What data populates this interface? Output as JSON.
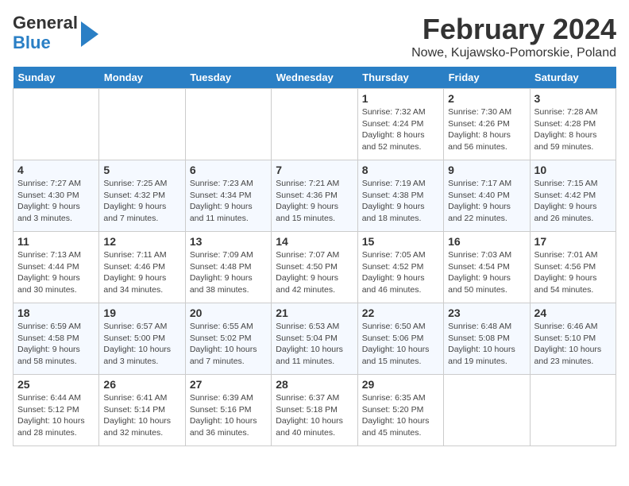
{
  "logo": {
    "line1": "General",
    "line2": "Blue"
  },
  "title": "February 2024",
  "subtitle": "Nowe, Kujawsko-Pomorskie, Poland",
  "header_days": [
    "Sunday",
    "Monday",
    "Tuesday",
    "Wednesday",
    "Thursday",
    "Friday",
    "Saturday"
  ],
  "weeks": [
    [
      {
        "day": "",
        "info": ""
      },
      {
        "day": "",
        "info": ""
      },
      {
        "day": "",
        "info": ""
      },
      {
        "day": "",
        "info": ""
      },
      {
        "day": "1",
        "info": "Sunrise: 7:32 AM\nSunset: 4:24 PM\nDaylight: 8 hours\nand 52 minutes."
      },
      {
        "day": "2",
        "info": "Sunrise: 7:30 AM\nSunset: 4:26 PM\nDaylight: 8 hours\nand 56 minutes."
      },
      {
        "day": "3",
        "info": "Sunrise: 7:28 AM\nSunset: 4:28 PM\nDaylight: 8 hours\nand 59 minutes."
      }
    ],
    [
      {
        "day": "4",
        "info": "Sunrise: 7:27 AM\nSunset: 4:30 PM\nDaylight: 9 hours\nand 3 minutes."
      },
      {
        "day": "5",
        "info": "Sunrise: 7:25 AM\nSunset: 4:32 PM\nDaylight: 9 hours\nand 7 minutes."
      },
      {
        "day": "6",
        "info": "Sunrise: 7:23 AM\nSunset: 4:34 PM\nDaylight: 9 hours\nand 11 minutes."
      },
      {
        "day": "7",
        "info": "Sunrise: 7:21 AM\nSunset: 4:36 PM\nDaylight: 9 hours\nand 15 minutes."
      },
      {
        "day": "8",
        "info": "Sunrise: 7:19 AM\nSunset: 4:38 PM\nDaylight: 9 hours\nand 18 minutes."
      },
      {
        "day": "9",
        "info": "Sunrise: 7:17 AM\nSunset: 4:40 PM\nDaylight: 9 hours\nand 22 minutes."
      },
      {
        "day": "10",
        "info": "Sunrise: 7:15 AM\nSunset: 4:42 PM\nDaylight: 9 hours\nand 26 minutes."
      }
    ],
    [
      {
        "day": "11",
        "info": "Sunrise: 7:13 AM\nSunset: 4:44 PM\nDaylight: 9 hours\nand 30 minutes."
      },
      {
        "day": "12",
        "info": "Sunrise: 7:11 AM\nSunset: 4:46 PM\nDaylight: 9 hours\nand 34 minutes."
      },
      {
        "day": "13",
        "info": "Sunrise: 7:09 AM\nSunset: 4:48 PM\nDaylight: 9 hours\nand 38 minutes."
      },
      {
        "day": "14",
        "info": "Sunrise: 7:07 AM\nSunset: 4:50 PM\nDaylight: 9 hours\nand 42 minutes."
      },
      {
        "day": "15",
        "info": "Sunrise: 7:05 AM\nSunset: 4:52 PM\nDaylight: 9 hours\nand 46 minutes."
      },
      {
        "day": "16",
        "info": "Sunrise: 7:03 AM\nSunset: 4:54 PM\nDaylight: 9 hours\nand 50 minutes."
      },
      {
        "day": "17",
        "info": "Sunrise: 7:01 AM\nSunset: 4:56 PM\nDaylight: 9 hours\nand 54 minutes."
      }
    ],
    [
      {
        "day": "18",
        "info": "Sunrise: 6:59 AM\nSunset: 4:58 PM\nDaylight: 9 hours\nand 58 minutes."
      },
      {
        "day": "19",
        "info": "Sunrise: 6:57 AM\nSunset: 5:00 PM\nDaylight: 10 hours\nand 3 minutes."
      },
      {
        "day": "20",
        "info": "Sunrise: 6:55 AM\nSunset: 5:02 PM\nDaylight: 10 hours\nand 7 minutes."
      },
      {
        "day": "21",
        "info": "Sunrise: 6:53 AM\nSunset: 5:04 PM\nDaylight: 10 hours\nand 11 minutes."
      },
      {
        "day": "22",
        "info": "Sunrise: 6:50 AM\nSunset: 5:06 PM\nDaylight: 10 hours\nand 15 minutes."
      },
      {
        "day": "23",
        "info": "Sunrise: 6:48 AM\nSunset: 5:08 PM\nDaylight: 10 hours\nand 19 minutes."
      },
      {
        "day": "24",
        "info": "Sunrise: 6:46 AM\nSunset: 5:10 PM\nDaylight: 10 hours\nand 23 minutes."
      }
    ],
    [
      {
        "day": "25",
        "info": "Sunrise: 6:44 AM\nSunset: 5:12 PM\nDaylight: 10 hours\nand 28 minutes."
      },
      {
        "day": "26",
        "info": "Sunrise: 6:41 AM\nSunset: 5:14 PM\nDaylight: 10 hours\nand 32 minutes."
      },
      {
        "day": "27",
        "info": "Sunrise: 6:39 AM\nSunset: 5:16 PM\nDaylight: 10 hours\nand 36 minutes."
      },
      {
        "day": "28",
        "info": "Sunrise: 6:37 AM\nSunset: 5:18 PM\nDaylight: 10 hours\nand 40 minutes."
      },
      {
        "day": "29",
        "info": "Sunrise: 6:35 AM\nSunset: 5:20 PM\nDaylight: 10 hours\nand 45 minutes."
      },
      {
        "day": "",
        "info": ""
      },
      {
        "day": "",
        "info": ""
      }
    ]
  ]
}
